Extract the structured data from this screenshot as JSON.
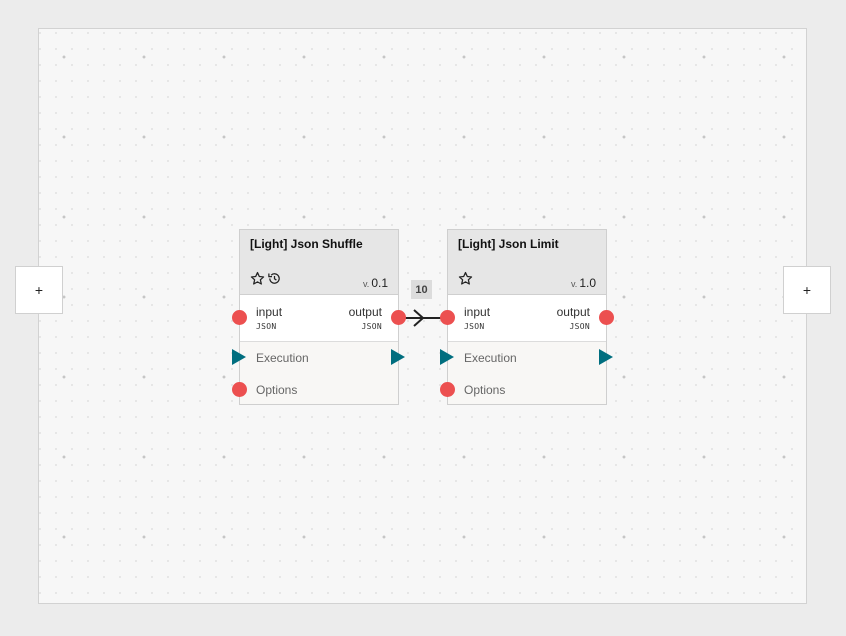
{
  "side_buttons": {
    "left_label": "+",
    "right_label": "+"
  },
  "edge": {
    "badge": "10"
  },
  "nodes": [
    {
      "title": "[Light] Json Shuffle",
      "version_prefix": "v.",
      "version": "0.1",
      "icons": [
        "star-icon",
        "history-icon"
      ],
      "input_label": "input",
      "input_type": "JSON",
      "output_label": "output",
      "output_type": "JSON",
      "execution_label": "Execution",
      "options_label": "Options"
    },
    {
      "title": "[Light] Json Limit",
      "version_prefix": "v.",
      "version": "1.0",
      "icons": [
        "star-icon"
      ],
      "input_label": "input",
      "input_type": "JSON",
      "output_label": "output",
      "output_type": "JSON",
      "execution_label": "Execution",
      "options_label": "Options"
    }
  ],
  "colors": {
    "port": "#ec5050",
    "execution": "#006e7f",
    "canvas": "#f7f7f7",
    "header": "#e6e6e6"
  }
}
